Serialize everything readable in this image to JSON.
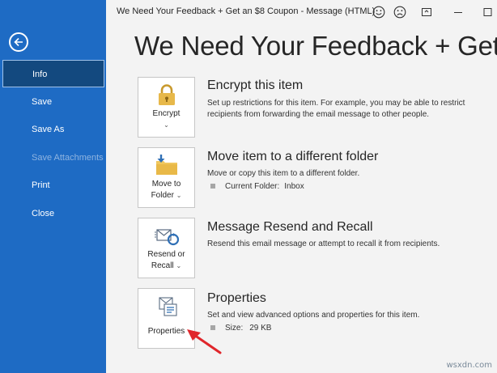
{
  "window": {
    "title": "We Need Your Feedback + Get an $8 Coupon  -  Message (HTML)"
  },
  "sidebar": {
    "items": [
      {
        "label": "Info",
        "active": true
      },
      {
        "label": "Save"
      },
      {
        "label": "Save As"
      },
      {
        "label": "Save Attachments",
        "disabled": true
      },
      {
        "label": "Print"
      },
      {
        "label": "Close"
      }
    ]
  },
  "main": {
    "page_title": "We Need Your Feedback + Get",
    "sections": [
      {
        "button_label": "Encrypt",
        "title": "Encrypt this item",
        "description": "Set up restrictions for this item. For example, you may be able to restrict recipients from forwarding the email message to other people.",
        "icon": "lock-icon"
      },
      {
        "button_label_line1": "Move to",
        "button_label_line2": "Folder",
        "title": "Move item to a different folder",
        "description": "Move or copy this item to a different folder.",
        "detail_label": "Current Folder:",
        "detail_value": "Inbox",
        "icon": "move-to-folder-icon"
      },
      {
        "button_label_line1": "Resend or",
        "button_label_line2": "Recall",
        "title": "Message Resend and Recall",
        "description": "Resend this email message or attempt to recall it from recipients.",
        "icon": "resend-recall-icon"
      },
      {
        "button_label": "Properties",
        "title": "Properties",
        "description": "Set and view advanced options and properties for this item.",
        "detail_label": "Size:",
        "detail_value": "29 KB",
        "icon": "properties-icon"
      }
    ]
  },
  "watermark": "wsxdn.com",
  "colors": {
    "sidebar": "#1e6bc4",
    "sidebar_active": "#13497f",
    "annotation_arrow": "#e0262b"
  }
}
